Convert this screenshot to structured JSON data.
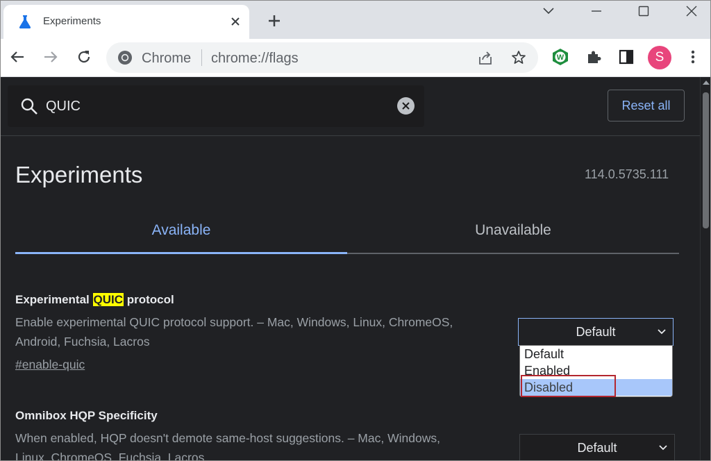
{
  "browser": {
    "tab": {
      "title": "Experiments",
      "icon": "flask-icon"
    },
    "site_chip": "Chrome",
    "url": "chrome://flags",
    "profile_initial": "S"
  },
  "page": {
    "search": {
      "value": "QUIC"
    },
    "reset_label": "Reset all",
    "title": "Experiments",
    "version": "114.0.5735.111",
    "tabs": {
      "available": "Available",
      "unavailable": "Unavailable"
    },
    "flags": [
      {
        "name_pre": "Experimental ",
        "name_highlight": "QUIC",
        "name_post": " protocol",
        "desc_line1": "Enable experimental QUIC protocol support. – Mac, Windows, Linux, ChromeOS,",
        "desc_line2": "Android, Fuchsia, Lacros",
        "link": "#enable-quic",
        "selected": "Default",
        "options": [
          "Default",
          "Enabled",
          "Disabled"
        ],
        "hovered_option": "Disabled"
      },
      {
        "name": "Omnibox HQP Specificity",
        "desc_line1": "When enabled, HQP doesn't demote same-host suggestions. – Mac, Windows,",
        "desc_line2": "Linux, ChromeOS, Fuchsia, Lacros",
        "selected": "Default"
      }
    ]
  },
  "colors": {
    "accent": "#8ab4f8",
    "highlight": "#ffff00",
    "page_bg": "#202124",
    "annotation": "#b3262e"
  }
}
